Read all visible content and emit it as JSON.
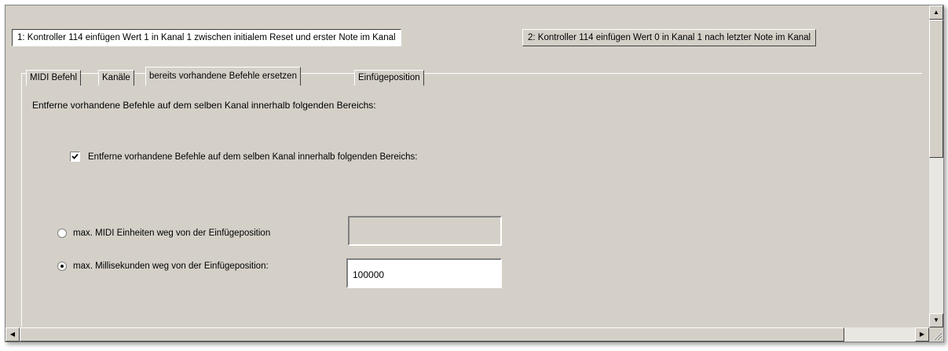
{
  "top_tabs": [
    {
      "label": "1: Kontroller 114 einfügen Wert 1 in Kanal 1 zwischen initialem Reset und erster Note im Kanal",
      "active": true
    },
    {
      "label": "2: Kontroller 114 einfügen Wert 0 in Kanal 1 nach letzter Note im Kanal",
      "active": false
    }
  ],
  "sub_tabs": [
    {
      "label": "MIDI Befehl",
      "active": false
    },
    {
      "label": "Kanäle",
      "active": false
    },
    {
      "label": "bereits vorhandene Befehle ersetzen",
      "active": true
    },
    {
      "label": "Einfügeposition",
      "active": false
    }
  ],
  "description": "Entferne vorhandene Befehle auf dem selben Kanal innerhalb folgenden Bereichs:",
  "remove_checkbox": {
    "label": "Entferne vorhandene Befehle auf dem selben Kanal innerhalb folgenden Bereichs:",
    "checked": true
  },
  "range_options": {
    "midi_units": {
      "label": "max. MIDI Einheiten weg von der Einfügeposition",
      "selected": false,
      "value": ""
    },
    "milliseconds": {
      "label": "max. Millisekunden weg von der Einfügeposition:",
      "selected": true,
      "value": "100000"
    }
  },
  "icons": {
    "scroll_up": "arrow-up-icon",
    "scroll_down": "arrow-down-icon",
    "scroll_left": "arrow-left-icon",
    "scroll_right": "arrow-right-icon",
    "resize_grip": "resize-grip-icon"
  },
  "colors": {
    "window_bg": "#d4d0c8",
    "active_tab_bg": "#ffffff",
    "input_bg": "#ffffff"
  }
}
